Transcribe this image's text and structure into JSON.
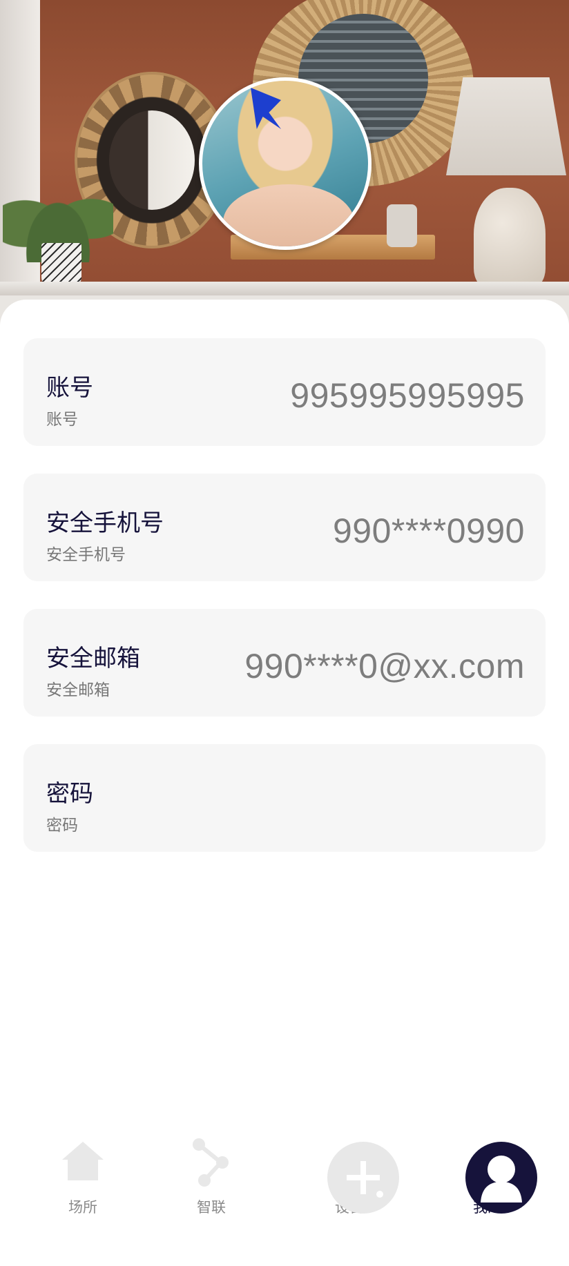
{
  "header": {
    "photo_icon": "header-photo",
    "avatar_icon": "avatar-image"
  },
  "account": {
    "rows": [
      {
        "title": "账号",
        "subtitle": "账号",
        "value": "995995995995"
      },
      {
        "title": "安全手机号",
        "subtitle": "安全手机号",
        "value": "990****0990"
      },
      {
        "title": "安全邮箱",
        "subtitle": "安全邮箱",
        "value": "990****0@xx.com"
      },
      {
        "title": "密码",
        "subtitle": "密码",
        "value": ""
      }
    ]
  },
  "nav": {
    "items": [
      {
        "label": "场所",
        "icon": "home-icon"
      },
      {
        "label": "智联",
        "icon": "connection-icon"
      },
      {
        "label": "设备",
        "icon": "add-icon"
      },
      {
        "label": "我的",
        "icon": "user-icon"
      }
    ],
    "active_color": "#16133b",
    "inactive_color": "#e8e8e8"
  }
}
